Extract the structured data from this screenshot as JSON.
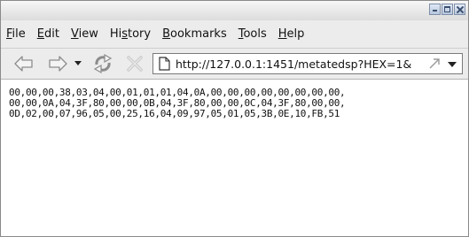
{
  "menu": {
    "items": [
      {
        "mnemonic": "F",
        "rest": "ile"
      },
      {
        "mnemonic": "E",
        "rest": "dit"
      },
      {
        "mnemonic": "V",
        "rest": "iew"
      },
      {
        "pre": "Hi",
        "mnemonic": "s",
        "rest": "tory"
      },
      {
        "mnemonic": "B",
        "rest": "ookmarks"
      },
      {
        "mnemonic": "T",
        "rest": "ools"
      },
      {
        "mnemonic": "H",
        "rest": "elp"
      }
    ]
  },
  "navigation": {
    "url": "http://127.0.0.1:1451/metatedsp?HEX=1&",
    "icons": [
      "back-arrow-icon",
      "forward-arrow-icon",
      "history-dropdown-icon",
      "reload-icon",
      "stop-icon",
      "page-icon",
      "go-arrow-icon",
      "url-dropdown-icon"
    ]
  },
  "content": {
    "lines": [
      "00,00,00,38,03,04,00,01,01,01,04,0A,00,00,00,00,00,00,00,00,",
      "00,00,0A,04,3F,80,00,00,0B,04,3F,80,00,00,0C,04,3F,80,00,00,",
      "0D,02,00,07,96,05,00,25,16,04,09,97,05,01,05,3B,0E,10,FB,51"
    ]
  }
}
